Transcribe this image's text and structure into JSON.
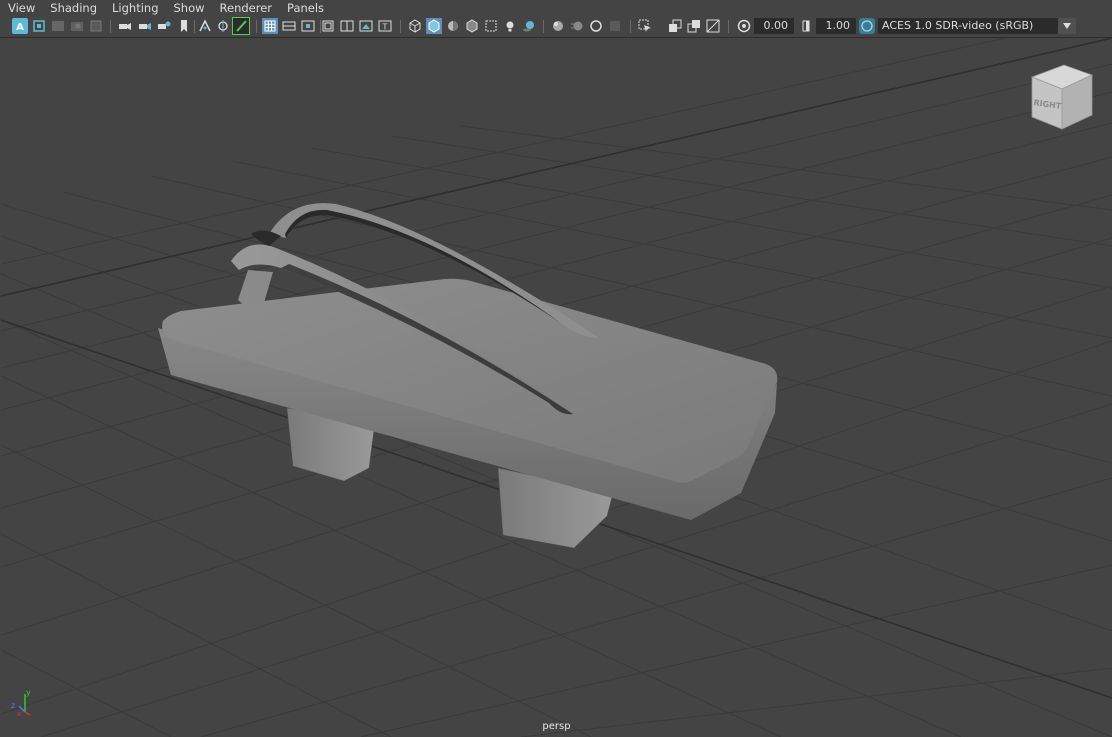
{
  "menu": [
    "View",
    "Shading",
    "Lighting",
    "Show",
    "Renderer",
    "Panels"
  ],
  "toolbar": {
    "exposure": "0.00",
    "gamma": "1.00",
    "color_space": "ACES 1.0 SDR-video (sRGB)",
    "icons": [
      "select-camera-icon",
      "camera-attributes-icon",
      "bookmarks-icon",
      "image-plane-icon",
      "2d-pan-zoom-icon",
      "grease-pencil-icon",
      "grid-icon",
      "film-gate-icon",
      "resolution-gate-icon",
      "gate-mask-icon",
      "field-chart-icon",
      "safe-action-icon",
      "safe-title-icon",
      "wireframe-icon",
      "smooth-shade-icon",
      "default-material-icon",
      "wireframe-on-shaded-icon",
      "xray-icon",
      "use-all-lights-icon",
      "shadows-icon",
      "screen-space-ao-icon",
      "motion-blur-icon",
      "multisample-aa-icon",
      "depth-of-field-icon",
      "isolate-select-icon",
      "xray-joints-icon",
      "xray-active-components-icon",
      "exposure-icon",
      "gamma-icon",
      "color-management-icon"
    ],
    "accent": "#5fb8d6"
  },
  "viewport": {
    "camera": "persp",
    "viewcube_face": "RIGHT",
    "background": "#444444",
    "grid_color": "#3a3a3a",
    "axis_labels": {
      "y": "y",
      "x": "x",
      "z": "z"
    }
  }
}
